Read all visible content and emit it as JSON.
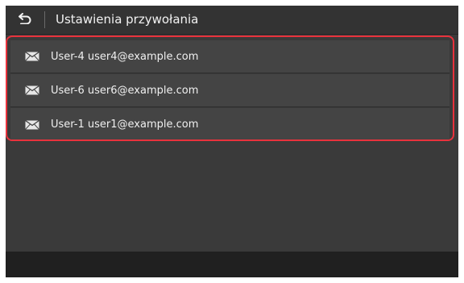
{
  "header": {
    "back_icon": "back-arrow-icon",
    "title": "Ustawienia przywołania"
  },
  "recall_list": {
    "items": [
      {
        "icon": "envelope-icon",
        "label": "User-4 user4@example.com"
      },
      {
        "icon": "envelope-icon",
        "label": "User-6 user6@example.com"
      },
      {
        "icon": "envelope-icon",
        "label": "User-1 user1@example.com"
      }
    ]
  },
  "colors": {
    "highlight": "#e8323c",
    "background": "#3a3a3a",
    "item_background": "#444444",
    "text": "#f0f0f0"
  }
}
